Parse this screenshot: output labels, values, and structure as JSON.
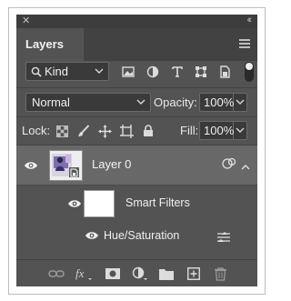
{
  "panel": {
    "close_glyph": "✕",
    "collapse_glyph": "‹‹",
    "tab_label": "Layers"
  },
  "filter": {
    "kind_label": "Kind",
    "icons": [
      "image-filter-icon",
      "adjustment-filter-icon",
      "type-filter-icon",
      "shape-filter-icon",
      "smart-object-filter-icon"
    ]
  },
  "blend": {
    "mode": "Normal",
    "opacity_label": "Opacity:",
    "opacity_value": "100%"
  },
  "lock": {
    "label": "Lock:",
    "fill_label": "Fill:",
    "fill_value": "100%",
    "icons": [
      "lock-transparent-pixels-icon",
      "lock-image-pixels-icon",
      "lock-position-icon",
      "lock-artboard-icon",
      "lock-all-icon"
    ]
  },
  "layers": [
    {
      "name": "Layer 0",
      "type": "smart-object",
      "visible": true,
      "selected": true
    },
    {
      "name": "Smart Filters",
      "type": "smart-filters",
      "visible": true
    },
    {
      "name": "Hue/Saturation",
      "type": "filter",
      "visible": true
    }
  ],
  "colors": {
    "panel_bg": "#535353",
    "selected_row": "#686868",
    "input_bg": "#3a3a3a"
  },
  "bottom_icons": [
    "link-layers-icon",
    "fx-icon",
    "add-mask-icon",
    "new-fill-adjustment-icon",
    "new-group-icon",
    "new-layer-icon",
    "delete-layer-icon"
  ]
}
